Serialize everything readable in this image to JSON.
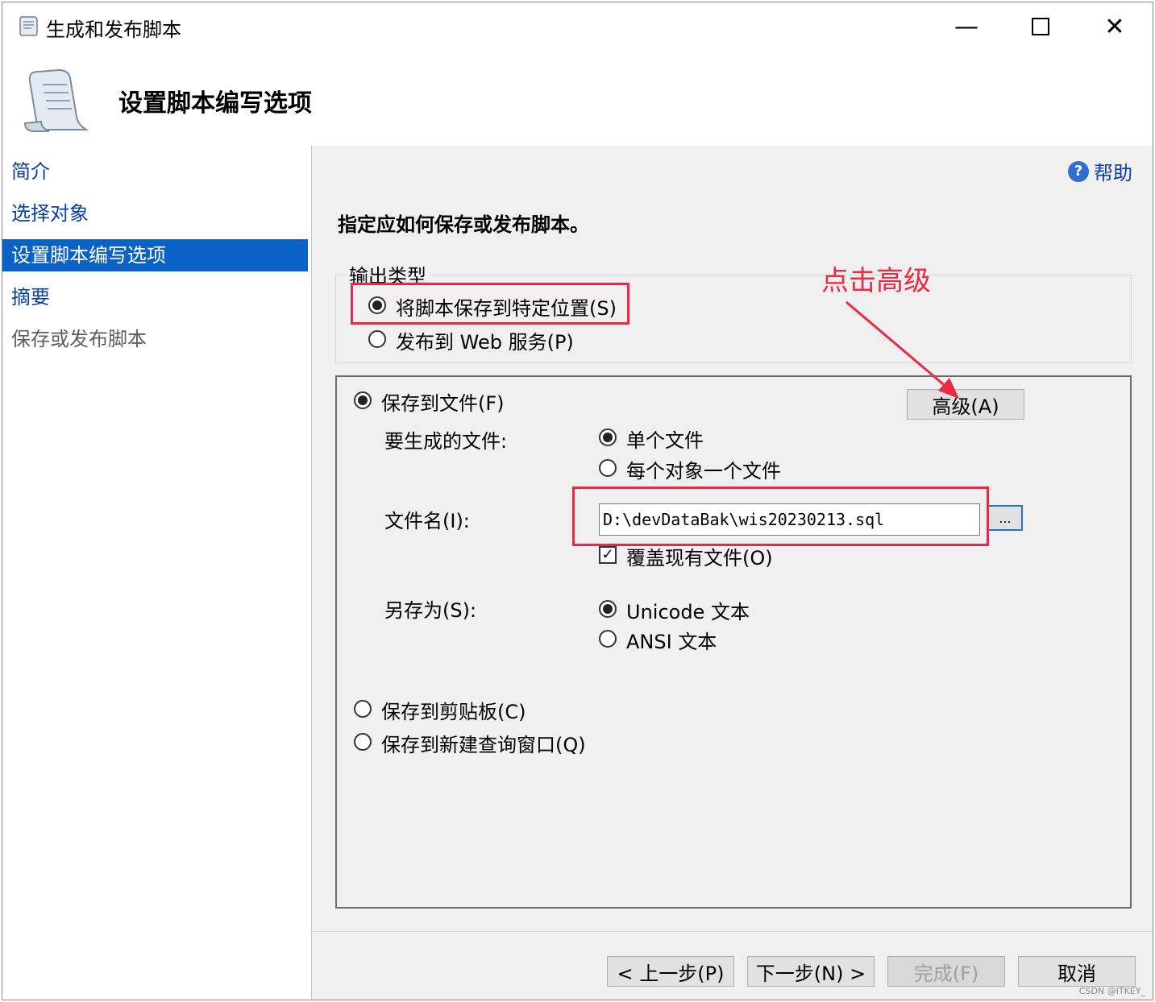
{
  "window": {
    "title": "生成和发布脚本",
    "header_title": "设置脚本编写选项"
  },
  "sidebar": {
    "items": [
      {
        "label": "简介"
      },
      {
        "label": "选择对象"
      },
      {
        "label": "设置脚本编写选项"
      },
      {
        "label": "摘要"
      },
      {
        "label": "保存或发布脚本"
      }
    ]
  },
  "content": {
    "help_label": "帮助",
    "instruction": "指定应如何保存或发布脚本。",
    "output_type": {
      "legend": "输出类型",
      "option_save": "将脚本保存到特定位置(S)",
      "option_web": "发布到 Web 服务(P)"
    },
    "save_to_file": {
      "label": "保存到文件(F)",
      "advanced_button": "高级(A)",
      "files_to_generate_label": "要生成的文件:",
      "single_file": "单个文件",
      "file_per_object": "每个对象一个文件",
      "file_name_label": "文件名(I):",
      "file_name_value": "D:\\devDataBak\\wis20230213.sql",
      "browse_button": "...",
      "overwrite_label": "覆盖现有文件(O)",
      "save_as_label": "另存为(S):",
      "unicode_text": "Unicode 文本",
      "ansi_text": "ANSI 文本"
    },
    "save_to_clipboard": "保存到剪贴板(C)",
    "save_to_query_window": "保存到新建查询窗口(Q)"
  },
  "annotation": {
    "text": "点击高级",
    "color": "#ee2a44"
  },
  "footer": {
    "prev_button": "< 上一步(P)",
    "next_button": "下一步(N) >",
    "finish_button": "完成(F)",
    "cancel_button": "取消"
  },
  "watermark": "CSDN @ITKEY_"
}
